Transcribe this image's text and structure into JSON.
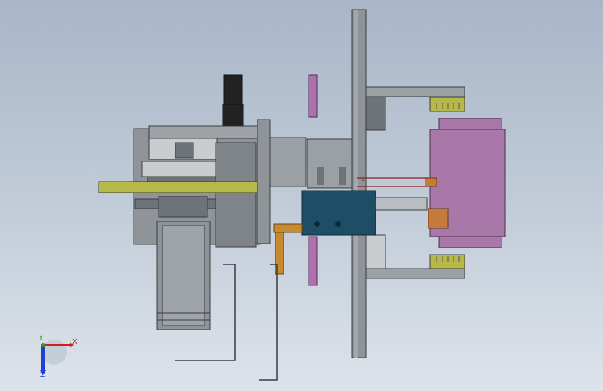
{
  "view": {
    "title": "",
    "background_top": "#a8b6c8",
    "background_bottom": "#dde3ea"
  },
  "triad": {
    "x_label": "X",
    "y_label": "Y",
    "z_label": "Z",
    "x_color": "#d12020",
    "y_color": "#20a020",
    "z_color": "#2040d0"
  },
  "annotations": {
    "small_tag": "S"
  },
  "colors": {
    "steel": "#8f9498",
    "steel_dark": "#6e7377",
    "steel_light": "#c9cdd0",
    "olive": "#b7b84a",
    "purple": "#a878a8",
    "teal": "#1d4e66",
    "brass": "#c78a2e",
    "copper": "#c47a3a",
    "black": "#222222"
  }
}
